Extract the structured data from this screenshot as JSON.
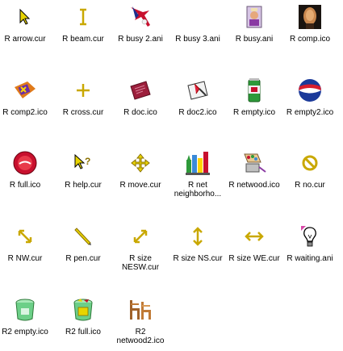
{
  "files": [
    {
      "name": "R arrow.cur",
      "icon": "arrow-cursor-icon"
    },
    {
      "name": "R beam.cur",
      "icon": "text-beam-cursor-icon"
    },
    {
      "name": "R busy 2.ani",
      "icon": "busy-animated-icon"
    },
    {
      "name": "R busy 3.ani",
      "icon": "busy-animated-icon"
    },
    {
      "name": "R busy.ani",
      "icon": "busy-animated-icon"
    },
    {
      "name": "R comp.ico",
      "icon": "computer-icon"
    },
    {
      "name": "R comp2.ico",
      "icon": "computer-icon"
    },
    {
      "name": "R cross.cur",
      "icon": "crosshair-cursor-icon"
    },
    {
      "name": "R doc.ico",
      "icon": "document-icon"
    },
    {
      "name": "R doc2.ico",
      "icon": "document-icon"
    },
    {
      "name": "R empty.ico",
      "icon": "empty-can-icon"
    },
    {
      "name": "R empty2.ico",
      "icon": "empty-can-icon"
    },
    {
      "name": "R full.ico",
      "icon": "full-can-icon"
    },
    {
      "name": "R help.cur",
      "icon": "help-cursor-icon"
    },
    {
      "name": "R move.cur",
      "icon": "move-cursor-icon"
    },
    {
      "name": "R net neighborho...",
      "icon": "network-neighborhood-icon"
    },
    {
      "name": "R netwood.ico",
      "icon": "network-icon"
    },
    {
      "name": "R no.cur",
      "icon": "no-cursor-icon"
    },
    {
      "name": "R NW.cur",
      "icon": "resize-diagonal-cursor-icon"
    },
    {
      "name": "R pen.cur",
      "icon": "pen-cursor-icon"
    },
    {
      "name": "R size NESW.cur",
      "icon": "resize-diagonal-cursor-icon"
    },
    {
      "name": "R size NS.cur",
      "icon": "resize-vertical-cursor-icon"
    },
    {
      "name": "R size WE.cur",
      "icon": "resize-horizontal-cursor-icon"
    },
    {
      "name": "R waiting.ani",
      "icon": "waiting-bulb-icon"
    },
    {
      "name": "R2 empty.ico",
      "icon": "empty-bin-icon"
    },
    {
      "name": "R2 full.ico",
      "icon": "full-bin-icon"
    },
    {
      "name": "R2 netwood2.ico",
      "icon": "network-icon"
    }
  ]
}
